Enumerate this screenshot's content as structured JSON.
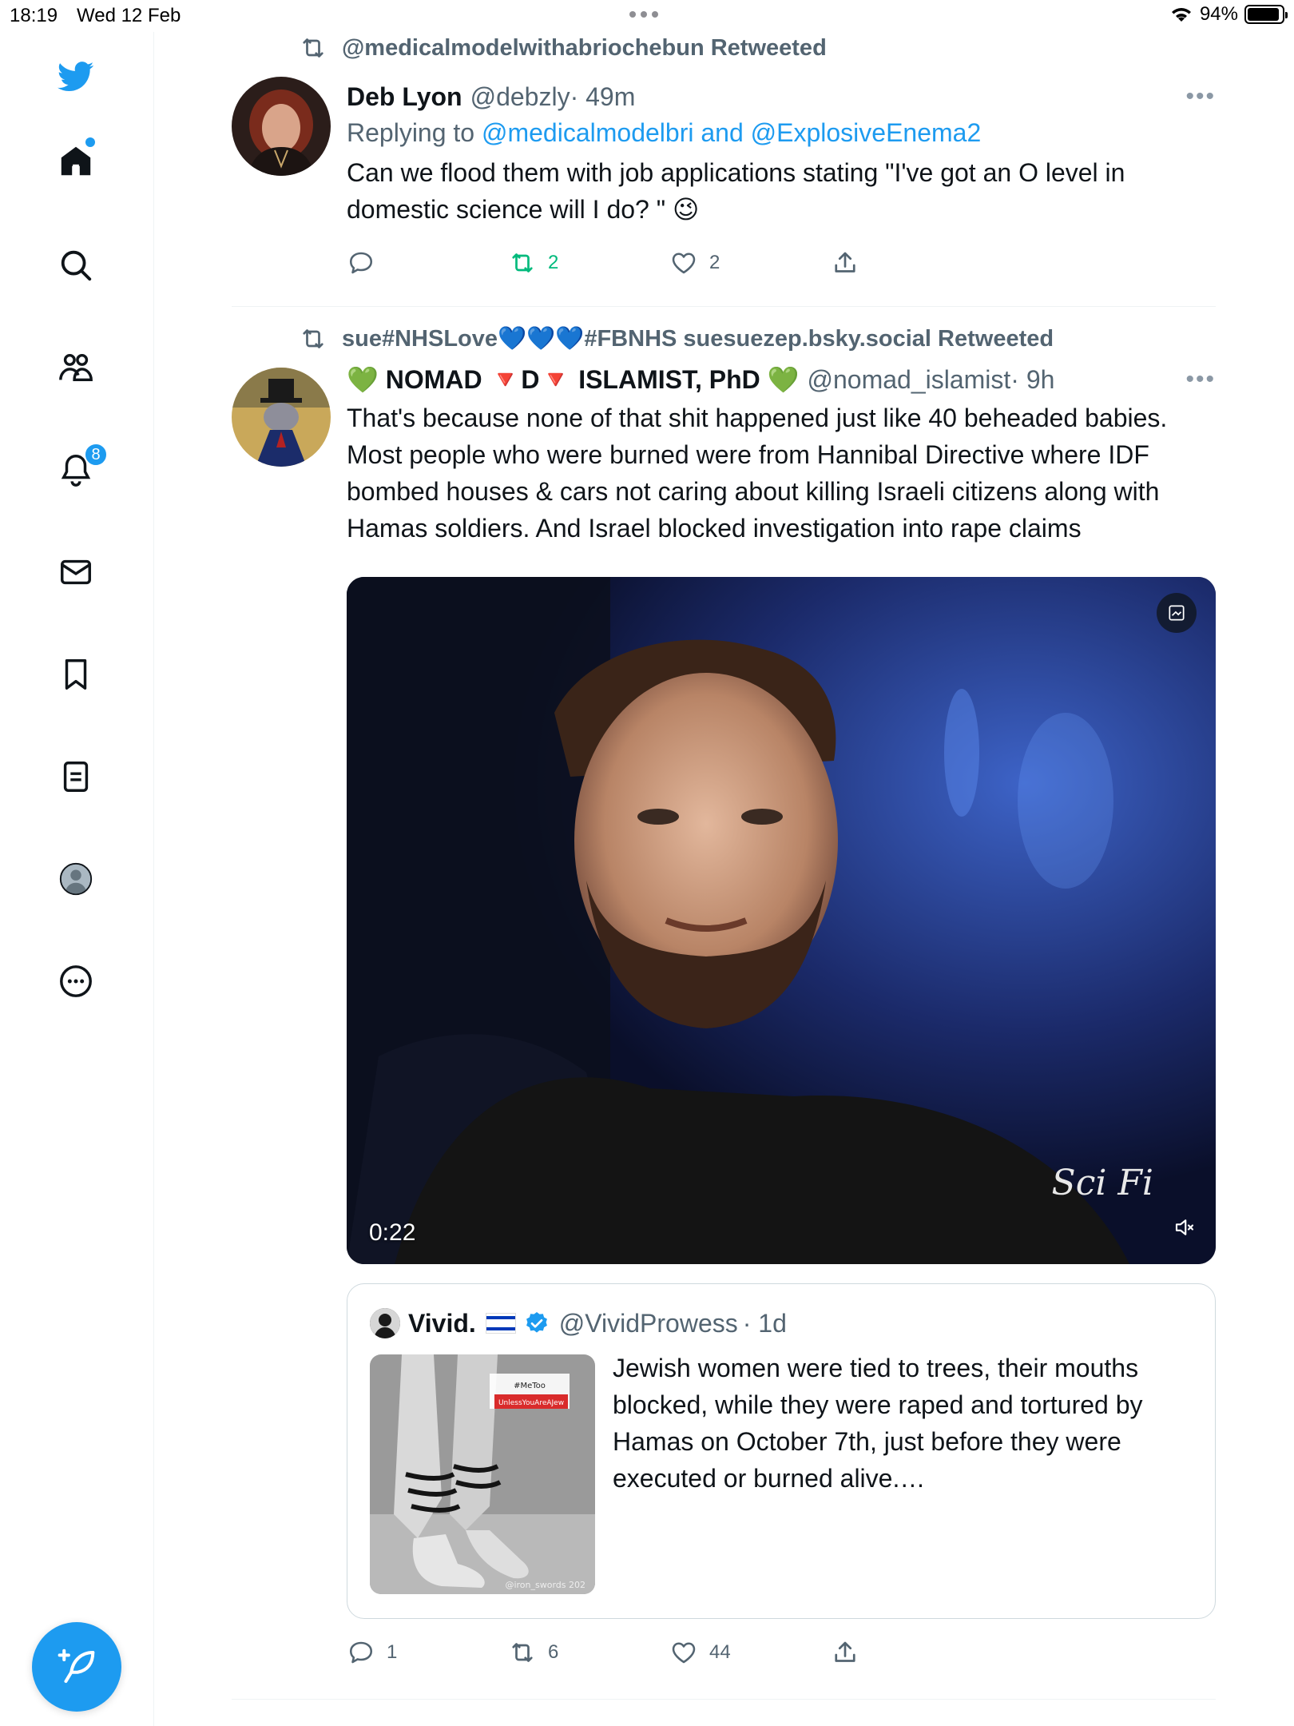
{
  "status_bar": {
    "time": "18:19",
    "date": "Wed 12 Feb",
    "battery": "94%",
    "battery_level": 0.94
  },
  "sidebar": {
    "items": [
      {
        "name": "home",
        "icon": "home-icon"
      },
      {
        "name": "explore",
        "icon": "search-icon"
      },
      {
        "name": "communities",
        "icon": "people-icon"
      },
      {
        "name": "notifications",
        "icon": "bell-icon",
        "badge": "8"
      },
      {
        "name": "messages",
        "icon": "mail-icon"
      },
      {
        "name": "bookmarks",
        "icon": "bookmark-icon"
      },
      {
        "name": "lists",
        "icon": "list-icon"
      },
      {
        "name": "profile",
        "icon": "profile-icon"
      },
      {
        "name": "more",
        "icon": "more-circle-icon"
      }
    ],
    "brand_color": "#1d9bf0"
  },
  "tweets": [
    {
      "retweeted_by": "@medicalmodelwithabriochebun Retweeted",
      "name": "Deb Lyon",
      "handle": "@debzly",
      "time": "· 49m",
      "replying_prefix": "Replying to",
      "replying_to_1": "@medicalmodelbri",
      "replying_and": "and",
      "replying_to_2": "@ExplosiveEnema2",
      "text": "Can we flood them with job applications stating \"I've got an O level in domestic science will I do? \" 😉",
      "replies": "",
      "retweets": "2",
      "likes": "2"
    },
    {
      "retweeted_by": "sue#NHSLove💙💙💙#FBNHS suesuezep.bsky.social Retweeted",
      "name": "💚 NOMAD 🔻D🔻 ISLAMIST, PhD 💚",
      "handle": "@nomad_islamist",
      "time": "· 9h",
      "text": "That's because none of that shit happened just like 40 beheaded babies. Most people who were burned were from Hannibal Directive where IDF bombed houses & cars not caring about killing Israeli citizens along with Hamas soldiers. And Israel blocked investigation into rape claims",
      "video_duration": "0:22",
      "video_watermark": "Sci Fi",
      "quote": {
        "name": "Vivid.",
        "handle": "@VividProwess",
        "time": "· 1d",
        "text": "Jewish women were tied to trees, their mouths blocked, while they were raped and tortured by Hamas on October 7th, just before they were executed or burned alive.…",
        "image_tag_1": "#MeToo",
        "image_tag_2": "UnlessYouAreAJew",
        "image_credit": "@iron_swords 202"
      },
      "replies": "1",
      "retweets": "6",
      "likes": "44"
    }
  ]
}
